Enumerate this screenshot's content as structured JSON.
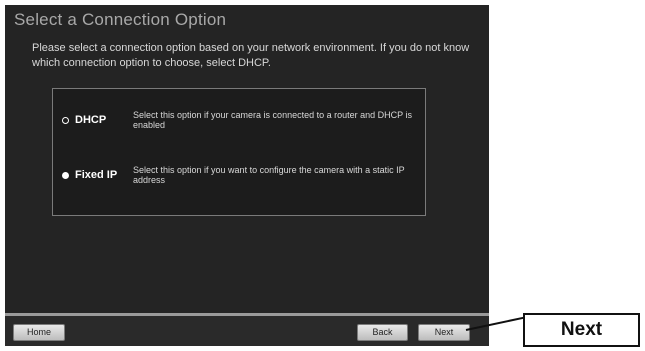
{
  "window": {
    "title": "Select a Connection Option",
    "intro": "Please select a connection option based on your network environment. If you do not know which connection option to choose, select DHCP."
  },
  "options": [
    {
      "label": "DHCP",
      "description": "Select this option if your camera is connected to a router and DHCP is enabled",
      "selected": false
    },
    {
      "label": "Fixed IP",
      "description": "Select this option if you want to configure the camera with a static IP address",
      "selected": true
    }
  ],
  "footer": {
    "home_label": "Home",
    "back_label": "Back",
    "next_label": "Next"
  },
  "callout": {
    "label": "Next"
  }
}
